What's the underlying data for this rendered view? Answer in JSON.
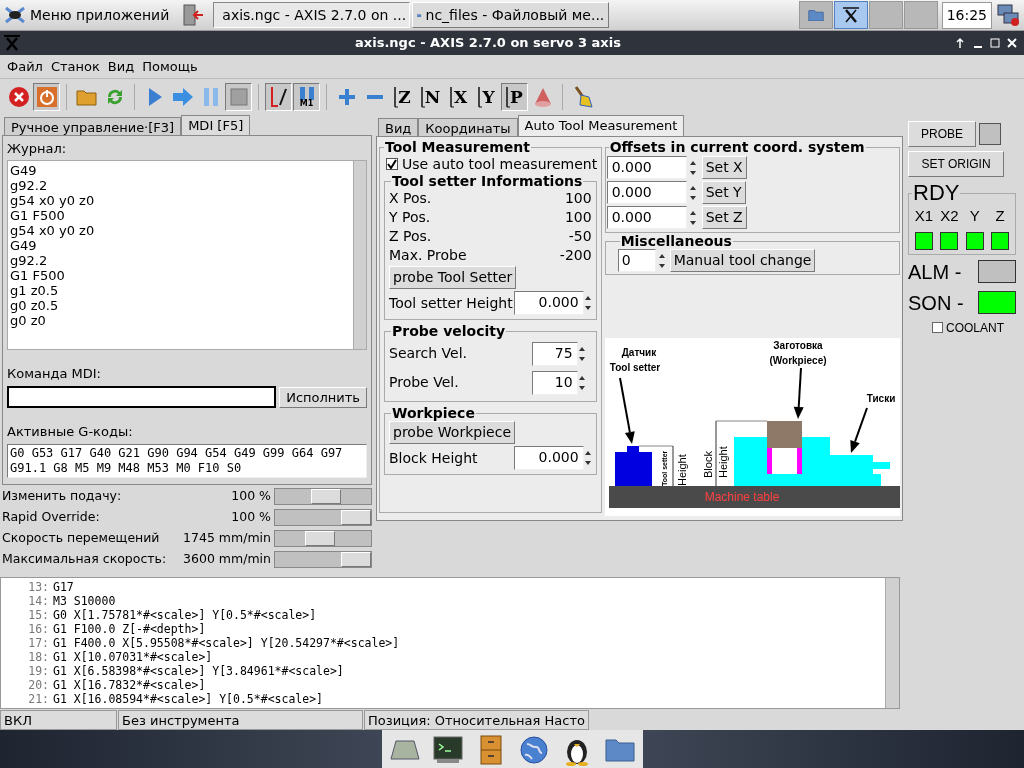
{
  "taskbar": {
    "menu_label": "Меню приложений",
    "tasks": [
      {
        "title": "axis.ngc - AXIS 2.7.0 on ...",
        "kind": "axis",
        "selected": true
      },
      {
        "title": "nc_files - Файловый ме...",
        "kind": "folder",
        "selected": false
      }
    ],
    "pager": [
      {
        "kind": "folder",
        "selected": false
      },
      {
        "kind": "axis",
        "selected": true
      },
      {
        "kind": "empty",
        "selected": false
      },
      {
        "kind": "empty",
        "selected": false
      }
    ],
    "clock": "16:25"
  },
  "window": {
    "title": "axis.ngc - AXIS 2.7.0 on servo 3 axis"
  },
  "menu": [
    "Файл",
    "Станок",
    "Вид",
    "Помощь"
  ],
  "toolbar": [
    {
      "kind": "estop",
      "pressed": false
    },
    {
      "kind": "power",
      "pressed": true
    },
    {
      "kind": "sep"
    },
    {
      "kind": "open",
      "pressed": false
    },
    {
      "kind": "reload",
      "pressed": false
    },
    {
      "kind": "sep"
    },
    {
      "kind": "run",
      "pressed": false
    },
    {
      "kind": "step",
      "pressed": false
    },
    {
      "kind": "pause",
      "pressed": false
    },
    {
      "kind": "stop",
      "pressed": true
    },
    {
      "kind": "sep"
    },
    {
      "kind": "toolpath",
      "pressed": true
    },
    {
      "kind": "m1",
      "label": "M1",
      "pressed": true
    },
    {
      "kind": "sep"
    },
    {
      "kind": "plus",
      "pressed": false
    },
    {
      "kind": "minus",
      "pressed": false
    },
    {
      "kind": "view",
      "label": "Z",
      "pressed": false
    },
    {
      "kind": "view",
      "label": "N",
      "pressed": false
    },
    {
      "kind": "view",
      "label": "X",
      "pressed": false
    },
    {
      "kind": "view",
      "label": "Y",
      "pressed": false
    },
    {
      "kind": "view",
      "label": "P",
      "pressed": true
    },
    {
      "kind": "cone",
      "pressed": false
    },
    {
      "kind": "sep"
    },
    {
      "kind": "brush",
      "pressed": false
    }
  ],
  "left_tabs": [
    {
      "label": "Ручное управление·[F3]",
      "selected": false
    },
    {
      "label": "MDI [F5]",
      "selected": true
    }
  ],
  "mdi": {
    "history_label": "Журнал:",
    "history": [
      "G49",
      "g92.2",
      "g54 x0 y0 z0",
      "G1 F500",
      "g54 x0 y0 z0",
      "G49",
      "g92.2",
      "G1 F500",
      "g1 z0.5",
      "g0 z0.5",
      "g0 z0"
    ],
    "command_label": "Команда MDI:",
    "execute": "Исполнить",
    "gcodes_label": "Активные G-коды:",
    "gcodes": [
      "G0 G53 G17 G40 G21 G90 G94 G54 G49 G99 G64 G97",
      "G91.1 G8 M5 M9 M48 M53 M0 F10 S0"
    ]
  },
  "overrides": [
    {
      "label": "Изменить подачу:",
      "reading": "100 %",
      "level": 0.55
    },
    {
      "label": "Rapid Override:",
      "reading": "100 %",
      "level": 1
    },
    {
      "label": "Скорость перемещений",
      "reading": "1745 mm/min",
      "level": 0.45
    },
    {
      "label": "Максимальная скорость:",
      "reading": "3600 mm/min",
      "level": 1
    }
  ],
  "center_tabs": [
    {
      "label": "Вид",
      "selected": false
    },
    {
      "label": "Координаты",
      "selected": false
    },
    {
      "label": "Auto Tool Measurement",
      "selected": true
    }
  ],
  "tool_measurement": {
    "title": "Tool Measurement",
    "use_auto": {
      "label": "Use auto tool measurement",
      "checked": true
    },
    "setter": {
      "title": "Tool setter Informations",
      "rows": [
        {
          "label": "X Pos.",
          "value": "100"
        },
        {
          "label": "Y Pos.",
          "value": "100"
        },
        {
          "label": "Z Pos.",
          "value": "-50"
        },
        {
          "label": "Max. Probe",
          "value": "-200"
        }
      ],
      "button": "probe Tool Setter",
      "height_label": "Tool setter Height",
      "height_value": "0.000"
    },
    "velocity": {
      "title": "Probe velocity",
      "rows": [
        {
          "label": "Search Vel.",
          "value": "75"
        },
        {
          "label": "Probe Vel.",
          "value": "10"
        }
      ]
    },
    "workpiece": {
      "title": "Workpiece",
      "button": "probe Workpiece",
      "height_label": "Block Height",
      "height_value": "0.000"
    }
  },
  "offsets": {
    "title": "Offsets in current coord. system",
    "rows": [
      {
        "value": "0.000",
        "button": "Set X"
      },
      {
        "value": "0.000",
        "button": "Set Y"
      },
      {
        "value": "0.000",
        "button": "Set Z"
      }
    ]
  },
  "misc": {
    "title": "Miscellaneous",
    "value": "0",
    "button": "Manual tool change"
  },
  "diagram": {
    "sensor_label": [
      "Датчик",
      "Tool setter"
    ],
    "workpiece_label": [
      "Заготовка",
      "(Workpiece)"
    ],
    "vise_label": "Тиски",
    "setter_height_label": [
      "Tool setter",
      "Height"
    ],
    "block_height_label": [
      "Block",
      "Height"
    ],
    "table_label": "Machine table"
  },
  "right": {
    "probe": "PROBE",
    "probe_on": false,
    "set_origin": "SET ORIGIN",
    "rdy_title": "RDY",
    "axes": [
      {
        "label": "X1",
        "on": true
      },
      {
        "label": "X2",
        "on": true
      },
      {
        "label": "Y",
        "on": true
      },
      {
        "label": "Z",
        "on": true
      }
    ],
    "signals": [
      {
        "label": "ALM -",
        "on": false
      },
      {
        "label": "SON -",
        "on": true
      }
    ],
    "coolant": {
      "label": "COOLANT",
      "checked": false
    }
  },
  "code": [
    {
      "number": "13:",
      "text": "G17"
    },
    {
      "number": "14:",
      "text": "M3 S10000"
    },
    {
      "number": "15:",
      "text": "G0 X[1.75781*#<scale>] Y[0.5*#<scale>]"
    },
    {
      "number": "16:",
      "text": "G1 F100.0 Z[-#<depth>]"
    },
    {
      "number": "17:",
      "text": "G1 F400.0 X[5.95508*#<scale>] Y[20.54297*#<scale>]"
    },
    {
      "number": "18:",
      "text": "G1 X[10.07031*#<scale>]"
    },
    {
      "number": "19:",
      "text": "G1 X[6.58398*#<scale>] Y[3.84961*#<scale>]"
    },
    {
      "number": "20:",
      "text": "G1 X[16.7832*#<scale>]"
    },
    {
      "number": "21:",
      "text": "G1 X[16.08594*#<scale>] Y[0.5*#<scale>]"
    }
  ],
  "status": [
    "ВКЛ",
    "Без инструмента",
    "Позиция: Относительная Насто"
  ],
  "dock": [
    {
      "kind": "drive"
    },
    {
      "kind": "terminal"
    },
    {
      "kind": "cabinet"
    },
    {
      "kind": "globe"
    },
    {
      "kind": "penguin"
    },
    {
      "kind": "folder"
    }
  ]
}
